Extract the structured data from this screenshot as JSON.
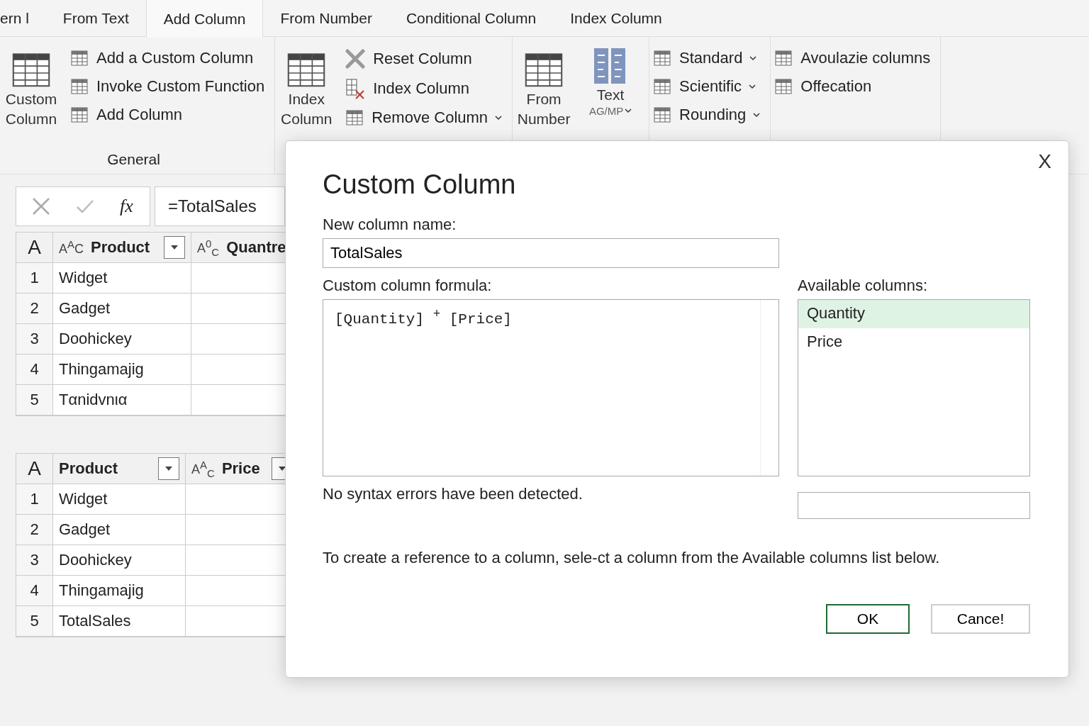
{
  "tabs": [
    {
      "label": "ern l",
      "selected": false
    },
    {
      "label": "From Text",
      "selected": false
    },
    {
      "label": "Add Column",
      "selected": true
    },
    {
      "label": "From Number",
      "selected": false
    },
    {
      "label": "Conditional Column",
      "selected": false
    },
    {
      "label": "Index Column",
      "selected": false
    }
  ],
  "ribbon": {
    "groups": [
      {
        "label": "General",
        "large": [
          {
            "label": "Custom Column",
            "dropdown": false
          }
        ],
        "items": [
          {
            "label": "Add a Custom Column",
            "dropdown": false
          },
          {
            "label": "Invoke Custom Function",
            "dropdown": false
          },
          {
            "label": "Add Column",
            "dropdown": false
          }
        ]
      },
      {
        "large": [
          {
            "label": "Index Column",
            "dropdown": false
          }
        ],
        "items": [
          {
            "label": "Reset Column",
            "dropdown": false
          },
          {
            "label": "Index Column",
            "dropdown": false
          },
          {
            "label": "Remove Column",
            "dropdown": true
          }
        ]
      },
      {
        "large": [
          {
            "label": "From Number",
            "dropdown": false
          },
          {
            "label": "Text",
            "sublabel": "AG/MP",
            "dropdown": true
          }
        ]
      },
      {
        "items": [
          {
            "label": "Standard",
            "dropdown": true
          },
          {
            "label": "Scientific",
            "dropdown": true
          },
          {
            "label": "Rounding",
            "dropdown": true
          }
        ]
      },
      {
        "items": [
          {
            "label": "Avoulazie columns",
            "dropdown": false
          },
          {
            "label": "Offecation",
            "dropdown": false
          }
        ]
      }
    ]
  },
  "formula_bar": {
    "fx": "fx",
    "value": "=TotalSales"
  },
  "tables": [
    {
      "corner": "A",
      "columns": [
        {
          "label": "Product",
          "type_icon": "A$^{A}$C",
          "filter": true
        },
        {
          "label": "Quantre",
          "type_icon": "A$^{0}$$_{C}$"
        }
      ],
      "rows": [
        {
          "index": "1",
          "cells": [
            "Widget"
          ]
        },
        {
          "index": "2",
          "cells": [
            "Gadget"
          ]
        },
        {
          "index": "3",
          "cells": [
            "Doohickey"
          ]
        },
        {
          "index": "4",
          "cells": [
            "Thingamajig"
          ]
        },
        {
          "index": "5",
          "cells": [
            "Tαnidvnια"
          ]
        }
      ]
    },
    {
      "corner": "A",
      "columns": [
        {
          "label": "Product",
          "filter": true
        },
        {
          "label": "Price",
          "type_icon": "A$^{A}$$_{C}$",
          "filter": true
        }
      ],
      "rows": [
        {
          "index": "1",
          "cells": [
            "Widget"
          ]
        },
        {
          "index": "2",
          "cells": [
            "Gadget"
          ]
        },
        {
          "index": "3",
          "cells": [
            "Doohickey"
          ]
        },
        {
          "index": "4",
          "cells": [
            "Thingamajig"
          ]
        },
        {
          "index": "5",
          "cells": [
            "TotalSales"
          ]
        }
      ]
    }
  ],
  "dialog": {
    "title": "Custom Column",
    "close": "X",
    "name_label": "New column name:",
    "name_value": "TotalSales",
    "formula_label": "Custom column formula:",
    "formula": "[Quantity] $^{+}$ [Price]",
    "available_label": "Available columns:",
    "available": [
      {
        "label": "Quantity",
        "selected": true
      },
      {
        "label": "Price",
        "selected": false
      }
    ],
    "status": "No syntax errors have been detected.",
    "hint": "To create a reference to a column, sele-ct a column from the Available columns list below.",
    "buttons": [
      {
        "label": "OK",
        "primary": true
      },
      {
        "label": "Cance!",
        "primary": false
      }
    ]
  }
}
